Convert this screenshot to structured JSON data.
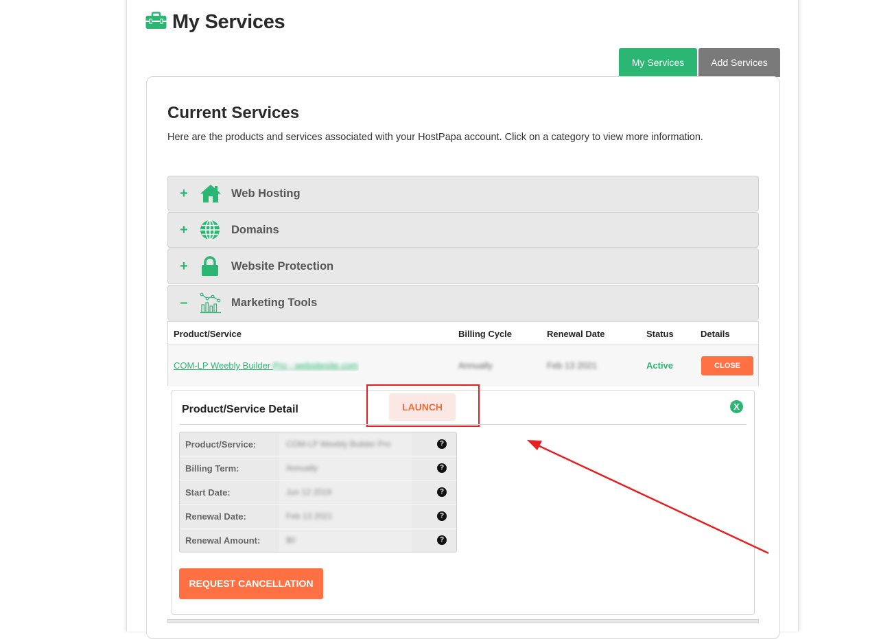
{
  "page": {
    "title": "My Services"
  },
  "tabs": {
    "my_services": "My Services",
    "add_services": "Add Services"
  },
  "section": {
    "title": "Current Services",
    "intro": "Here are the products and services associated with your HostPapa account. Click on a category to view more information."
  },
  "categories": [
    {
      "toggle": "+",
      "label": "Web Hosting",
      "icon": "house-icon"
    },
    {
      "toggle": "+",
      "label": "Domains",
      "icon": "globe-icon"
    },
    {
      "toggle": "+",
      "label": "Website Protection",
      "icon": "lock-icon"
    },
    {
      "toggle": "–",
      "label": "Marketing Tools",
      "icon": "chart-icon"
    }
  ],
  "table": {
    "headers": {
      "product": "Product/Service",
      "billing": "Billing Cycle",
      "renewal": "Renewal Date",
      "status": "Status",
      "details": "Details"
    },
    "row": {
      "product": "COM-LP Weebly Builder Pro - websitesite.com",
      "billing": "Annually",
      "renewal": "Feb 13 2021",
      "status": "Active",
      "action": "CLOSE"
    }
  },
  "detail": {
    "title": "Product/Service Detail",
    "launch": "LAUNCH",
    "close_x": "X",
    "rows": [
      {
        "label": "Product/Service:",
        "value": "COM-LP Weebly Builder Pro"
      },
      {
        "label": "Billing Term:",
        "value": "Annually"
      },
      {
        "label": "Start Date:",
        "value": "Jun 12 2019"
      },
      {
        "label": "Renewal Date:",
        "value": "Feb 13 2021"
      },
      {
        "label": "Renewal Amount:",
        "value": "$0"
      }
    ],
    "help": "?",
    "cancel": "REQUEST CANCELLATION"
  },
  "colors": {
    "brand_green": "#2bb673",
    "accent_orange": "#ff7043",
    "annotation_red": "#e62020"
  }
}
